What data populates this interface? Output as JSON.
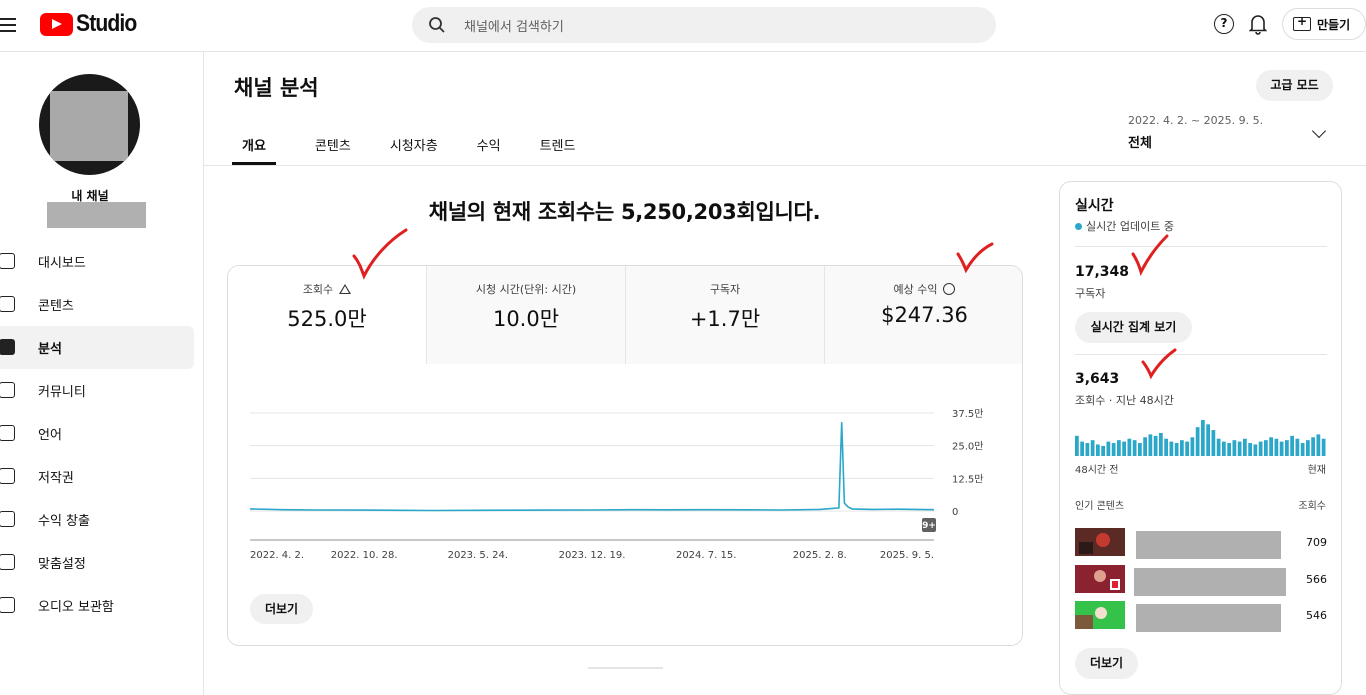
{
  "app": {
    "logo_text": "Studio"
  },
  "search": {
    "placeholder": "채널에서 검색하기"
  },
  "topbar": {
    "help": "?",
    "create_label": "만들기"
  },
  "sidebar": {
    "channel_label": "내 채널",
    "items": [
      {
        "label": "대시보드",
        "icon": "dashboard-icon"
      },
      {
        "label": "콘텐츠",
        "icon": "content-icon"
      },
      {
        "label": "분석",
        "icon": "analytics-icon",
        "active": true
      },
      {
        "label": "커뮤니티",
        "icon": "community-icon"
      },
      {
        "label": "언어",
        "icon": "subtitles-icon"
      },
      {
        "label": "저작권",
        "icon": "copyright-icon"
      },
      {
        "label": "수익 창출",
        "icon": "dollar-icon"
      },
      {
        "label": "맞춤설정",
        "icon": "magic-wand-icon"
      },
      {
        "label": "오디오 보관함",
        "icon": "music-icon"
      }
    ]
  },
  "page": {
    "title": "채널 분석",
    "advanced_mode": "고급 모드",
    "tabs": [
      "개요",
      "콘텐츠",
      "시청자층",
      "수익",
      "트렌드"
    ],
    "date_range": "2022. 4. 2. ~ 2025. 9. 5.",
    "date_scope": "전체",
    "headline": "채널의 현재 조회수는 5,250,203회입니다."
  },
  "metrics": [
    {
      "label": "조회수",
      "value": "525.0만",
      "icon": "warning-icon"
    },
    {
      "label": "시청 시간(단위: 시간)",
      "value": "10.0만"
    },
    {
      "label": "구독자",
      "value": "+1.7만"
    },
    {
      "label": "예상 수익",
      "value": "$247.36",
      "icon": "clock-icon"
    }
  ],
  "chart_data": {
    "type": "line",
    "x_ticks": [
      "2022. 4. 2.",
      "2022. 10. 28.",
      "2023. 5. 24.",
      "2023. 12. 19.",
      "2024. 7. 15.",
      "2025. 2. 8.",
      "2025. 9. 5."
    ],
    "y_ticks": [
      "0",
      "12.5만",
      "25.0만",
      "37.5만"
    ],
    "ylim": [
      0,
      375000
    ],
    "badge": "9+",
    "series": [
      {
        "color": "#2aa7c9",
        "x": [
          "2022. 4. 2.",
          "2022. 6. 1.",
          "2022. 8. 1.",
          "2022. 10. 28.",
          "2023. 1. 1.",
          "2023. 3. 1.",
          "2023. 5. 24.",
          "2023. 8. 1.",
          "2023. 10. 1.",
          "2023. 12. 19.",
          "2024. 3. 1.",
          "2024. 5. 1.",
          "2024. 7. 15.",
          "2024. 10. 1.",
          "2024. 12. 1.",
          "2025. 2. 8.",
          "2025. 3. 15.",
          "2025. 3. 20.",
          "2025. 3. 25.",
          "2025. 4. 1.",
          "2025. 4. 8.",
          "2025. 5. 15.",
          "2025. 7. 1.",
          "2025. 9. 5."
        ],
        "y": [
          8000,
          5000,
          4000,
          3500,
          2500,
          2000,
          2500,
          3000,
          3500,
          4000,
          5000,
          4500,
          5000,
          4500,
          4000,
          6000,
          12000,
          340000,
          30000,
          15000,
          8000,
          6000,
          7000,
          5000
        ]
      }
    ],
    "more_label": "더보기"
  },
  "realtime": {
    "title": "실시간",
    "live_label": "실시간 업데이트 중",
    "subs_value": "17,348",
    "subs_label": "구독자",
    "live_count_button": "실시간 집계 보기",
    "views_value": "3,643",
    "views_label": "조회수 · 지난 48시간",
    "bar_chart": {
      "type": "bar",
      "values": [
        14,
        10,
        9,
        11,
        8,
        7,
        10,
        9,
        11,
        10,
        12,
        11,
        9,
        13,
        15,
        14,
        16,
        12,
        10,
        9,
        11,
        10,
        13,
        20,
        25,
        22,
        18,
        12,
        10,
        9,
        11,
        10,
        12,
        9,
        8,
        10,
        11,
        13,
        12,
        10,
        11,
        14,
        12,
        9,
        11,
        13,
        15,
        12
      ],
      "color": "#2aa7c9"
    },
    "axis_left": "48시간 전",
    "axis_right": "현재",
    "top_content_label": "인기 콘텐츠",
    "views_col_label": "조회수",
    "top_items": [
      {
        "count": "709"
      },
      {
        "count": "566"
      },
      {
        "count": "546"
      }
    ],
    "more_label": "더보기"
  }
}
